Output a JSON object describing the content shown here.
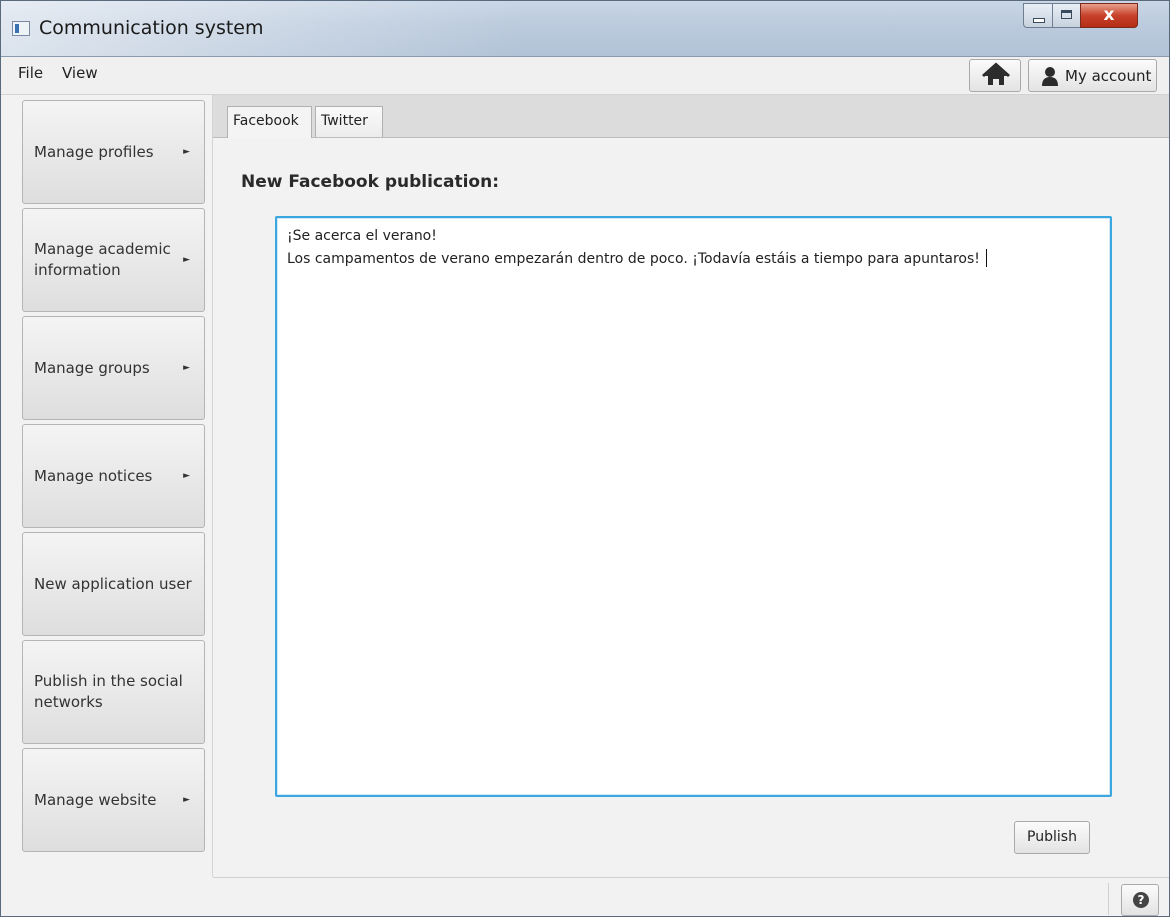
{
  "window": {
    "title": "Communication system",
    "close_glyph": "x"
  },
  "menubar": {
    "items": [
      "File",
      "View"
    ],
    "home_icon": "home-icon",
    "account_label": "My account",
    "account_icon": "user-icon"
  },
  "sidebar": {
    "items": [
      {
        "label": "Manage profiles",
        "has_submenu": true
      },
      {
        "label": "Manage academic information",
        "has_submenu": true
      },
      {
        "label": "Manage groups",
        "has_submenu": true
      },
      {
        "label": "Manage notices",
        "has_submenu": true
      },
      {
        "label": "New application user",
        "has_submenu": false
      },
      {
        "label": "Publish in the social networks",
        "has_submenu": false
      },
      {
        "label": "Manage website",
        "has_submenu": true
      }
    ],
    "arrow_glyph": "►"
  },
  "tabs": [
    {
      "label": "Facebook",
      "selected": true
    },
    {
      "label": "Twitter",
      "selected": false
    }
  ],
  "main": {
    "heading": "New Facebook publication:",
    "text_lines": [
      "¡Se acerca el verano!",
      "Los campamentos de verano empezarán dentro de poco. ¡Todavía estáis a tiempo para apuntaros!"
    ],
    "publish_label": "Publish"
  },
  "statusbar": {
    "help_glyph": "?"
  },
  "colors": {
    "accent_focus": "#3aa7e0",
    "close_button": "#c7422b"
  }
}
